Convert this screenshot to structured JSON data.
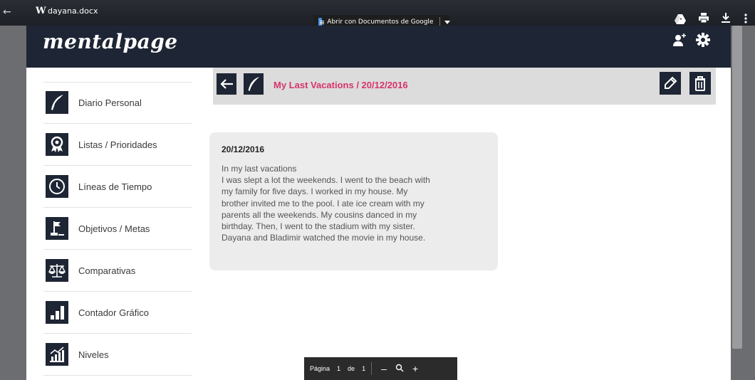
{
  "viewer": {
    "file_name": "dayana.docx",
    "file_icon": "word-icon",
    "open_with_label": "Abrir con Documentos de Google",
    "icons": [
      "back-arrow-icon",
      "drive-add-icon",
      "print-icon",
      "download-icon",
      "more-vert-icon"
    ]
  },
  "app": {
    "logo": "mentalpage",
    "header_icons": [
      "add-user-icon",
      "gear-icon"
    ]
  },
  "sidebar": {
    "items": [
      {
        "label": "Diario Personal",
        "icon": "feather-icon"
      },
      {
        "label": "Listas / Prioridades",
        "icon": "award-ribbon-icon"
      },
      {
        "label": "Líneas de Tiempo",
        "icon": "clock-icon"
      },
      {
        "label": "Objetivos / Metas",
        "icon": "goal-flag-icon"
      },
      {
        "label": "Comparativas",
        "icon": "balance-scale-icon"
      },
      {
        "label": "Contador Gráfico",
        "icon": "bar-chart-icon"
      },
      {
        "label": "Niveles",
        "icon": "levels-chart-icon"
      }
    ]
  },
  "content": {
    "title": "My Last Vacations / 20/12/2016",
    "icons": [
      "back-arrow-icon",
      "feather-icon",
      "edit-icon",
      "trash-icon"
    ]
  },
  "note": {
    "date": "20/12/2016",
    "lines": [
      "In my last vacations",
      "I was slept a lot the weekends. I went to the beach with",
      "my family for five days. I worked in my house. My",
      "brother invited me to the pool. I ate ice cream with my",
      "parents all the weekends. My cousins danced in my",
      "birthday. Then, I went to the stadium with my sister.",
      "Dayana and Bladimir watched the movie in my house."
    ]
  },
  "pager": {
    "page_label": "Página",
    "current": "1",
    "of_label": "de",
    "total": "1",
    "zoom_out": "–",
    "zoom_in": "+"
  },
  "colors": {
    "header_bg": "#1e2534",
    "accent_title": "#d6336c",
    "content_head_bg": "#dcdcdc",
    "note_bg": "#ececec"
  }
}
